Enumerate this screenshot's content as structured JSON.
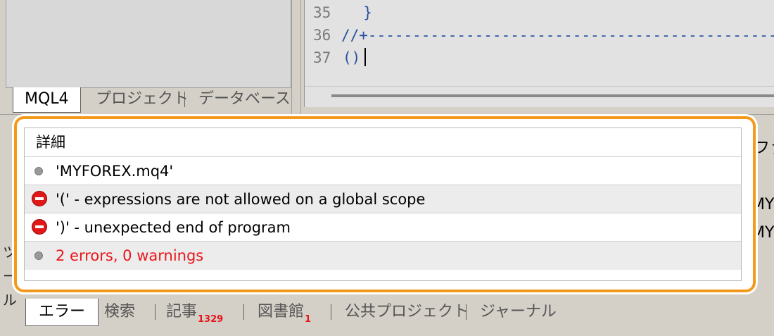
{
  "navigator": {
    "tabs": [
      "MQL4",
      "プロジェクト",
      "データベース"
    ]
  },
  "editor": {
    "lines": [
      {
        "number": "35",
        "code": "  }"
      },
      {
        "number": "36",
        "code": "//+-----------------------------------------------"
      },
      {
        "number": "37",
        "code": "()"
      }
    ]
  },
  "toolbox": {
    "peek_right_header": "ファ",
    "peek_right_rows": [
      "MY",
      "MY"
    ],
    "sidebar_glyphs": [
      "ツ",
      "ー",
      "ル"
    ],
    "list": {
      "header": "詳細",
      "rows": [
        {
          "icon": "info-dot-icon",
          "text": "'MYFOREX.mq4'"
        },
        {
          "icon": "error-icon",
          "text": "'(' - expressions are not allowed on a global scope"
        },
        {
          "icon": "error-icon",
          "text": "')' - unexpected end of program"
        },
        {
          "icon": "info-dot-icon",
          "text": "2 errors, 0 warnings"
        }
      ]
    },
    "tabs": [
      {
        "label": "エラー",
        "badge": ""
      },
      {
        "label": "検索",
        "badge": ""
      },
      {
        "label": "記事",
        "badge": "1329"
      },
      {
        "label": "図書館",
        "badge": "1"
      },
      {
        "label": "公共プロジェクト",
        "badge": ""
      },
      {
        "label": "ジャーナル",
        "badge": ""
      }
    ]
  },
  "colors": {
    "highlight_border": "#f39a1c",
    "error_text": "#e8151b",
    "code_text": "#2850a0"
  }
}
